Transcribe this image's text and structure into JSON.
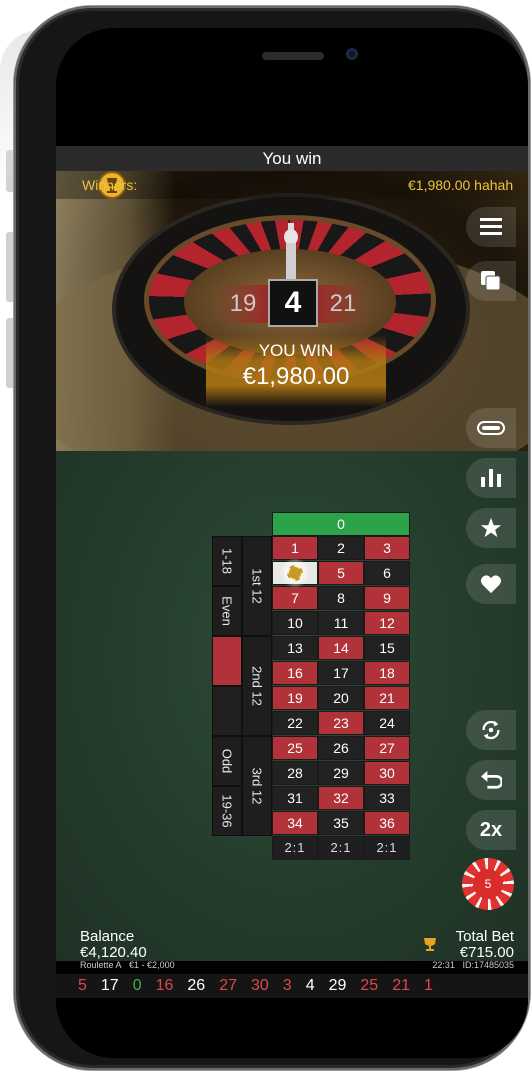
{
  "title_bar": {
    "text": "You win"
  },
  "winners": {
    "label": "Winners:",
    "value": "€1,980.00 hahah"
  },
  "result": {
    "number": "4",
    "left_number": "19",
    "right_number": "21"
  },
  "win_banner": {
    "line1": "YOU WIN",
    "amount": "€1,980.00"
  },
  "grid": {
    "zero": "0",
    "rows": [
      [
        {
          "n": "1",
          "c": "red"
        },
        {
          "n": "2",
          "c": "black"
        },
        {
          "n": "3",
          "c": "red"
        }
      ],
      [
        {
          "n": "",
          "c": "lit"
        },
        {
          "n": "5",
          "c": "red"
        },
        {
          "n": "6",
          "c": "black"
        }
      ],
      [
        {
          "n": "7",
          "c": "red"
        },
        {
          "n": "8",
          "c": "black"
        },
        {
          "n": "9",
          "c": "red"
        }
      ],
      [
        {
          "n": "10",
          "c": "black"
        },
        {
          "n": "11",
          "c": "black"
        },
        {
          "n": "12",
          "c": "red"
        }
      ],
      [
        {
          "n": "13",
          "c": "black"
        },
        {
          "n": "14",
          "c": "red"
        },
        {
          "n": "15",
          "c": "black"
        }
      ],
      [
        {
          "n": "16",
          "c": "red"
        },
        {
          "n": "17",
          "c": "black"
        },
        {
          "n": "18",
          "c": "red"
        }
      ],
      [
        {
          "n": "19",
          "c": "red"
        },
        {
          "n": "20",
          "c": "black"
        },
        {
          "n": "21",
          "c": "red"
        }
      ],
      [
        {
          "n": "22",
          "c": "black"
        },
        {
          "n": "23",
          "c": "red"
        },
        {
          "n": "24",
          "c": "black"
        }
      ],
      [
        {
          "n": "25",
          "c": "red"
        },
        {
          "n": "26",
          "c": "black"
        },
        {
          "n": "27",
          "c": "red"
        }
      ],
      [
        {
          "n": "28",
          "c": "black"
        },
        {
          "n": "29",
          "c": "black"
        },
        {
          "n": "30",
          "c": "red"
        }
      ],
      [
        {
          "n": "31",
          "c": "black"
        },
        {
          "n": "32",
          "c": "red"
        },
        {
          "n": "33",
          "c": "black"
        }
      ],
      [
        {
          "n": "34",
          "c": "red"
        },
        {
          "n": "35",
          "c": "black"
        },
        {
          "n": "36",
          "c": "red"
        }
      ]
    ],
    "column_bets": [
      "2:1",
      "2:1",
      "2:1"
    ],
    "dozens": [
      "1st 12",
      "2nd 12",
      "3rd 12"
    ],
    "outside": [
      "1-18",
      "Even",
      "",
      "",
      "Odd",
      "19-36"
    ],
    "chip_label": "5"
  },
  "side_buttons": {
    "menu": "menu-icon",
    "windows": "windows-icon",
    "racetrack": "racetrack-icon",
    "stats": "stats-icon",
    "favorites": "star-icon",
    "likes": "heart-icon",
    "repeat": "repeat-icon",
    "undo": "undo-icon",
    "double": "2x"
  },
  "chip_selector": {
    "value": "5"
  },
  "balance": {
    "label": "Balance",
    "value": "€4,120.40",
    "table": "Roulette A",
    "limits": "€1 - €2,000"
  },
  "total_bet": {
    "label": "Total Bet",
    "value": "€715.00",
    "time": "22:31",
    "id": "ID:17485035"
  },
  "history": [
    {
      "n": "5",
      "c": "r"
    },
    {
      "n": "17",
      "c": "b"
    },
    {
      "n": "0",
      "c": "g"
    },
    {
      "n": "16",
      "c": "r"
    },
    {
      "n": "26",
      "c": "b"
    },
    {
      "n": "27",
      "c": "r"
    },
    {
      "n": "30",
      "c": "r"
    },
    {
      "n": "3",
      "c": "r"
    },
    {
      "n": "4",
      "c": "b"
    },
    {
      "n": "29",
      "c": "b"
    },
    {
      "n": "25",
      "c": "r"
    },
    {
      "n": "21",
      "c": "r"
    },
    {
      "n": "1",
      "c": "r"
    }
  ],
  "colors": {
    "red": "#b23239",
    "black": "#222222",
    "green": "#2ca24a",
    "gold": "#f0c23c",
    "felt": "#264030"
  }
}
